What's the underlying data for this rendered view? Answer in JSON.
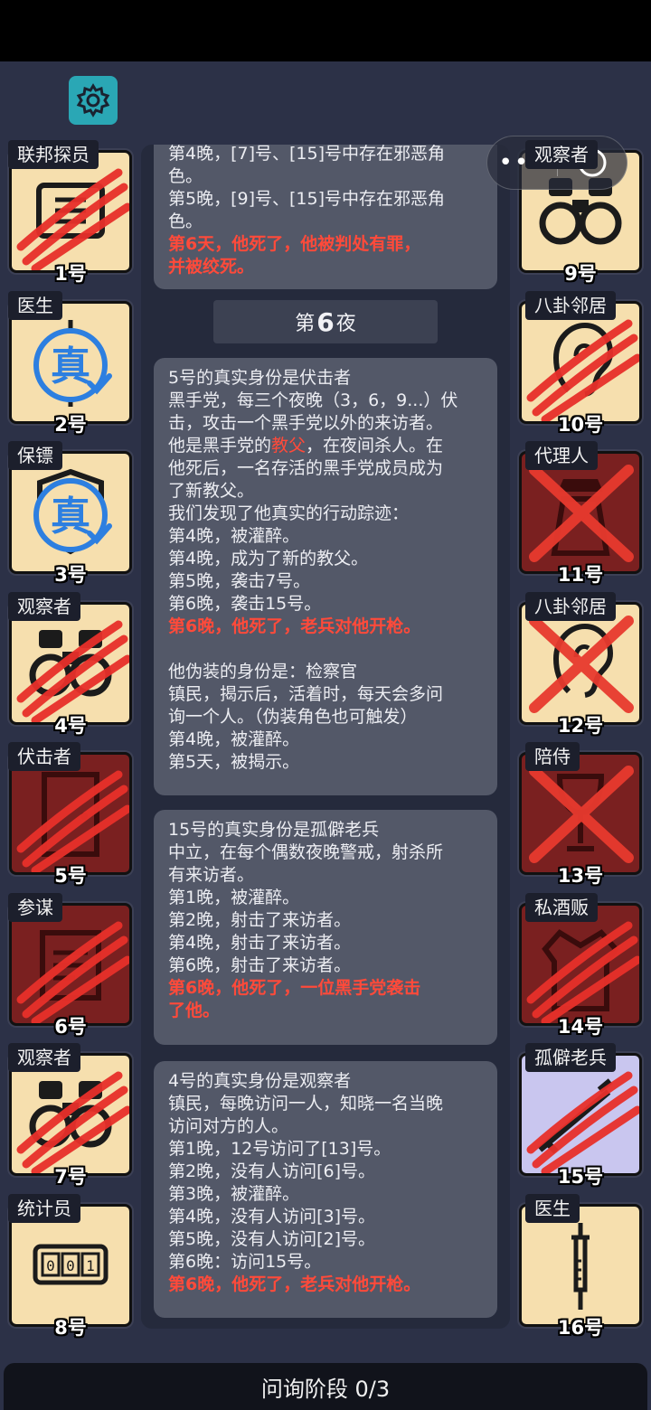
{
  "header": {
    "settings_icon": "gear-icon"
  },
  "capsule": {
    "more_label": "•••",
    "close_icon": "target-circle-icon"
  },
  "players_left": [
    {
      "role": "联邦探员",
      "num": "1号",
      "bg": "#f6dfae",
      "state": "claws",
      "icon": "fingerprint-scanner-icon"
    },
    {
      "role": "医生",
      "num": "2号",
      "bg": "#f6dfae",
      "state": "verified",
      "icon": "syringe-icon"
    },
    {
      "role": "保镖",
      "num": "3号",
      "bg": "#f6dfae",
      "state": "verified",
      "icon": "shield-icon"
    },
    {
      "role": "观察者",
      "num": "4号",
      "bg": "#f6dfae",
      "state": "claws",
      "icon": "binoculars-icon"
    },
    {
      "role": "伏击者",
      "num": "5号",
      "bg": "#7a2020",
      "state": "claws",
      "icon": "door-icon"
    },
    {
      "role": "参谋",
      "num": "6号",
      "bg": "#7a2020",
      "state": "claws",
      "icon": "document-icon"
    },
    {
      "role": "观察者",
      "num": "7号",
      "bg": "#f6dfae",
      "state": "claws",
      "icon": "binoculars-icon"
    },
    {
      "role": "统计员",
      "num": "8号",
      "bg": "#f6dfae",
      "state": "alive",
      "icon": "counter-icon"
    }
  ],
  "players_right": [
    {
      "role": "观察者",
      "num": "9号",
      "bg": "#f6dfae",
      "state": "alive",
      "icon": "binoculars-icon"
    },
    {
      "role": "八卦邻居",
      "num": "10号",
      "bg": "#f6dfae",
      "state": "claws",
      "icon": "ear-icon"
    },
    {
      "role": "代理人",
      "num": "11号",
      "bg": "#7a2020",
      "state": "cross",
      "icon": "hat-coat-icon"
    },
    {
      "role": "八卦邻居",
      "num": "12号",
      "bg": "#f6dfae",
      "state": "cross",
      "icon": "ear-icon"
    },
    {
      "role": "陪侍",
      "num": "13号",
      "bg": "#7a2020",
      "state": "cross",
      "icon": "wine-glass-icon"
    },
    {
      "role": "私酒贩",
      "num": "14号",
      "bg": "#7a2020",
      "state": "claws",
      "icon": "coat-icon"
    },
    {
      "role": "孤僻老兵",
      "num": "15号",
      "bg": "#c9c6ef",
      "state": "claws",
      "icon": "rifle-icon"
    },
    {
      "role": "医生",
      "num": "16号",
      "bg": "#f6dfae",
      "state": "alive",
      "icon": "syringe-icon"
    }
  ],
  "verified_mark": "真",
  "log": {
    "card0": {
      "l1": "第4晚，[7]号、[15]号中存在邪恶角",
      "l2": "色。",
      "l3": "第5晚，[9]号、[15]号中存在邪恶角",
      "l4": "色。",
      "l5": "第6天，他死了，他被判处有罪，",
      "l6": "并被绞死。"
    },
    "night_prefix": "第",
    "night_num": "6",
    "night_suffix": "夜",
    "card1": {
      "l1": "5号的真实身份是伏击者",
      "l2": "黑手党，每三个夜晚（3，6，9...）伏",
      "l3": "击，攻击一个黑手党以外的来访者。",
      "l4a": "他是黑手党的",
      "l4b": "教父",
      "l4c": "，在夜间杀人。在",
      "l5": "他死后，一名存活的黑手党成员成为",
      "l6": "了新教父。",
      "l7": "我们发现了他真实的行动踪迹：",
      "l8": "第4晚，被灌醉。",
      "l9": "第4晚，成为了新的教父。",
      "l10": "第5晚，袭击7号。",
      "l11": "第6晚，袭击15号。",
      "l12": "第6晚，他死了，老兵对他开枪。",
      "l13": "他伪装的身份是：检察官",
      "l14": "镇民，揭示后，活着时，每天会多问",
      "l15": "询一个人。（伪装角色也可触发）",
      "l16": "第4晚，被灌醉。",
      "l17": "第5天，被揭示。"
    },
    "card2": {
      "l1": "15号的真实身份是孤僻老兵",
      "l2": "中立，在每个偶数夜晚警戒，射杀所",
      "l3": "有来访者。",
      "l4": "第1晚，被灌醉。",
      "l5": "第2晚，射击了来访者。",
      "l6": "第4晚，射击了来访者。",
      "l7": "第6晚，射击了来访者。",
      "l8": "第6晚，他死了，一位黑手党袭击",
      "l9": "了他。"
    },
    "card3": {
      "l1": "4号的真实身份是观察者",
      "l2": "镇民，每晚访问一人，知晓一名当晚",
      "l3": "访问对方的人。",
      "l4": "第1晚，12号访问了[13]号。",
      "l5": "第2晚，没有人访问[6]号。",
      "l6": "第3晚，被灌醉。",
      "l7": "第4晚，没有人访问[3]号。",
      "l8": "第5晚，没有人访问[2]号。",
      "l9": "第6晚：访问15号。",
      "l10": "第6晚，他死了，老兵对他开枪。"
    }
  },
  "footer": {
    "phase_label": "问询阶段 0/3"
  }
}
